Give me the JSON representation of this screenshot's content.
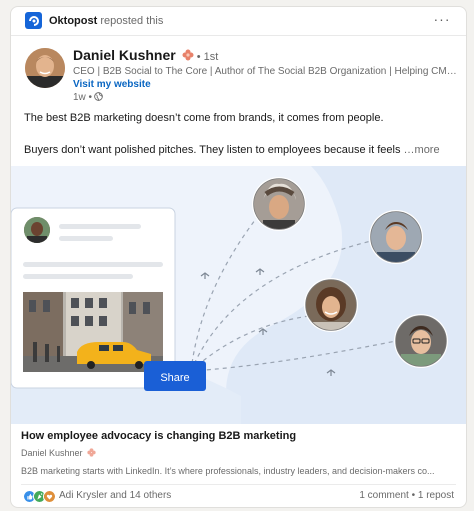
{
  "repost": {
    "company": "Oktopost",
    "action": "reposted this",
    "menu_glyph": "···"
  },
  "author": {
    "name": "Daniel Kushner",
    "degree": "• 1st",
    "headline": "CEO | B2B Social to The Core | Author of The Social B2B Organization | Helping CMOs...",
    "website_label": "Visit my website",
    "time": "1w •"
  },
  "post": {
    "line1": "The best B2B marketing doesn’t come from brands, it comes from people.",
    "line2": "Buyers don’t want polished pitches. They listen to employees because it feels",
    "see_more": "…more"
  },
  "image": {
    "share_button_label": "Share"
  },
  "link_preview": {
    "title": "How employee advocacy is changing B2B marketing",
    "author": "Daniel Kushner",
    "description": "B2B marketing starts with LinkedIn. It’s where professionals, industry leaders, and decision-makers co..."
  },
  "social": {
    "reactions_label": "Adi Krysler and 14 others",
    "comments": "1 comment",
    "separator": " • ",
    "reposts": "1 repost"
  },
  "colors": {
    "brand_blue": "#0a66c2",
    "share_button": "#1a5fd6",
    "hero_bg": "#eef3fb",
    "taxi_yellow": "#f3b21b"
  },
  "icons": {
    "repost_logo": "oktopost-logo-icon",
    "badge": "flower-badge-icon",
    "visibility": "globe-icon",
    "reactions": [
      "like-icon",
      "celebrate-icon",
      "support-icon"
    ]
  }
}
